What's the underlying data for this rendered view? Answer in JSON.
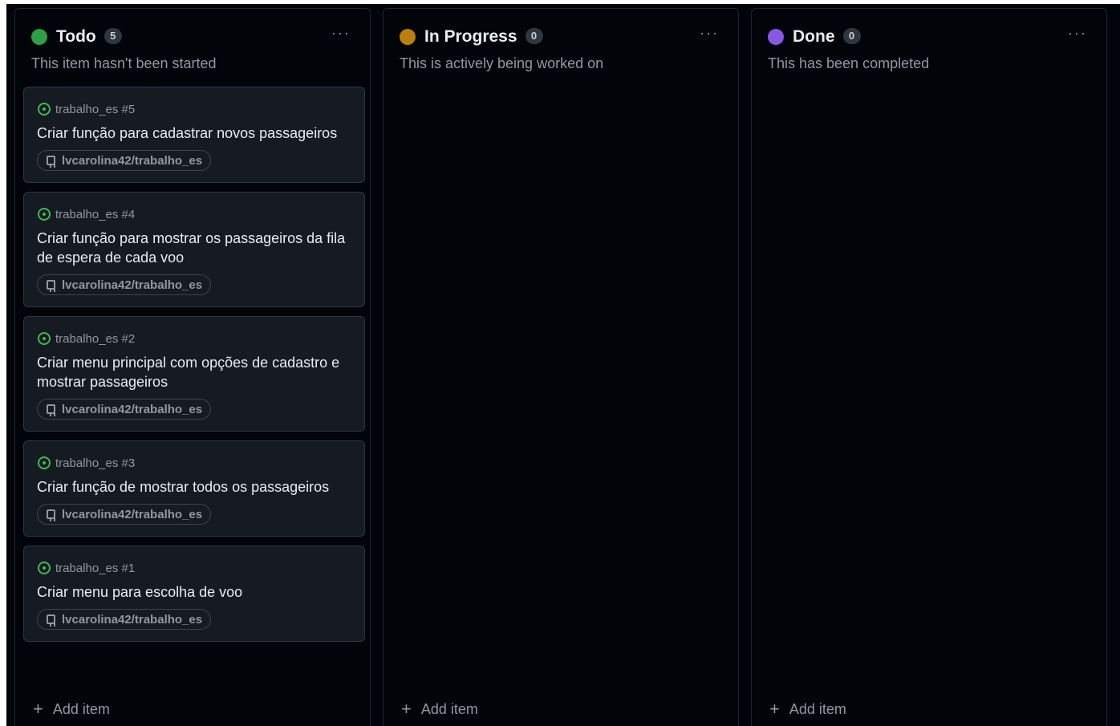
{
  "colors": {
    "todo": "#2ea043",
    "in_progress": "#bb8009",
    "done": "#8957e5"
  },
  "columns": [
    {
      "title": "Todo",
      "count": "5",
      "description": "This item hasn't been started",
      "more_label": "···",
      "add_label": "Add item",
      "cards": [
        {
          "meta": "trabalho_es #5",
          "title": "Criar função para cadastrar novos passageiros",
          "repo": "lvcarolina42/trabalho_es"
        },
        {
          "meta": "trabalho_es #4",
          "title": "Criar função para mostrar os passageiros da fila de espera de cada voo",
          "repo": "lvcarolina42/trabalho_es"
        },
        {
          "meta": "trabalho_es #2",
          "title": "Criar menu principal com opções de cadastro e mostrar passageiros",
          "repo": "lvcarolina42/trabalho_es"
        },
        {
          "meta": "trabalho_es #3",
          "title": "Criar função de mostrar todos os passageiros",
          "repo": "lvcarolina42/trabalho_es"
        },
        {
          "meta": "trabalho_es #1",
          "title": "Criar menu para escolha de voo",
          "repo": "lvcarolina42/trabalho_es"
        }
      ]
    },
    {
      "title": "In Progress",
      "count": "0",
      "description": "This is actively being worked on",
      "more_label": "···",
      "add_label": "Add item",
      "cards": []
    },
    {
      "title": "Done",
      "count": "0",
      "description": "This has been completed",
      "more_label": "···",
      "add_label": "Add item",
      "cards": []
    }
  ],
  "icons": {
    "issue": "issue-open-icon",
    "repo": "repo-icon",
    "plus": "plus-icon",
    "more": "kebab-horizontal-icon"
  }
}
